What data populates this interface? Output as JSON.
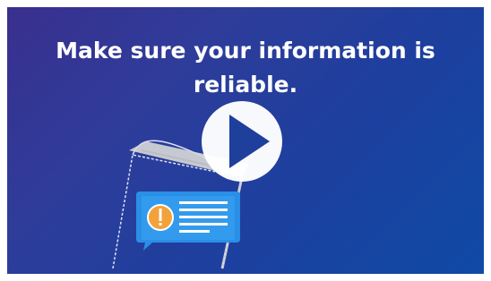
{
  "video": {
    "headline_line1": "Make sure your information is",
    "headline_line2": "reliable.",
    "play_icon": "play-icon",
    "phone_icon": "smartphone-icon",
    "message_icon": "message-bubble-icon",
    "info_icon": "info-icon",
    "colors": {
      "background_start": "#3a2f8f",
      "background_end": "#0f4aa6",
      "text": "#ffffff",
      "bubble": "#2a8fe6",
      "info_circle": "#f2a23a"
    }
  }
}
